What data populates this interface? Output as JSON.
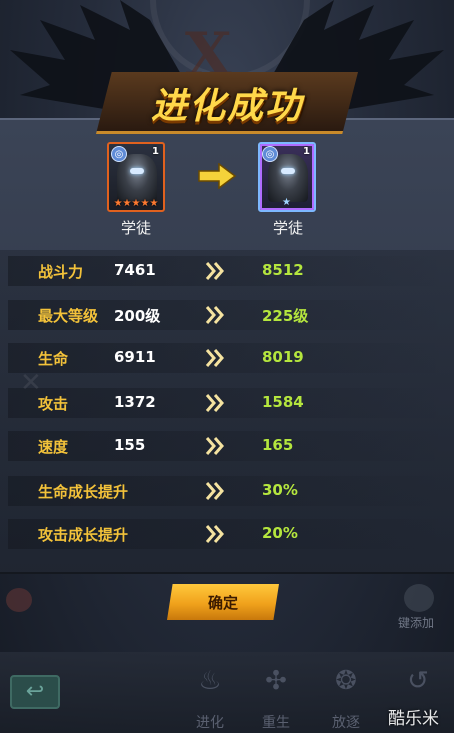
{
  "title": "进化成功",
  "hero_before": {
    "name": "学徒",
    "level": "1",
    "stars": "★★★★★"
  },
  "hero_after": {
    "name": "学徒",
    "level": "1"
  },
  "stats": [
    {
      "label": "战斗力",
      "old": "7461",
      "new": "8512"
    },
    {
      "label": "最大等级",
      "old": "200级",
      "new": "225级"
    },
    {
      "label": "生命",
      "old": "6911",
      "new": "8019"
    },
    {
      "label": "攻击",
      "old": "1372",
      "new": "1584"
    },
    {
      "label": "速度",
      "old": "155",
      "new": "165"
    },
    {
      "label": "生命成长提升",
      "old": "",
      "new": "30%"
    },
    {
      "label": "攻击成长提升",
      "old": "",
      "new": "20%"
    }
  ],
  "confirm_label": "确定",
  "bottom_nav": [
    {
      "label": "进化",
      "icon": "flame-icon"
    },
    {
      "label": "重生",
      "icon": "rebirth-icon"
    },
    {
      "label": "放逐",
      "icon": "swirl-icon"
    },
    {
      "label": "",
      "icon": "restore-icon"
    }
  ],
  "side_label": "键添加",
  "watermark": "酷乐米",
  "colors": {
    "label": "#f3c23a",
    "new_value": "#b5e63e",
    "title": "#ffd84a",
    "button": "#f0a21c"
  }
}
